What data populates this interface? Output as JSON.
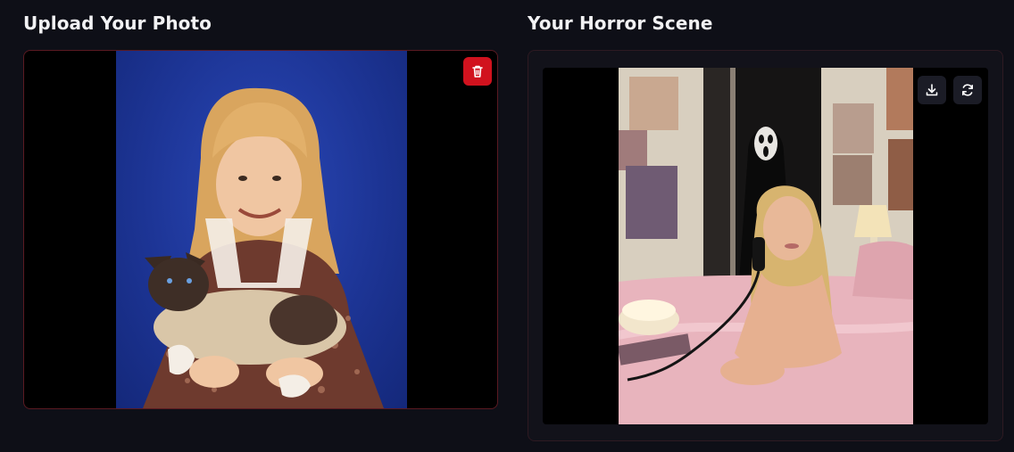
{
  "upload": {
    "title": "Upload Your Photo",
    "delete_icon": "trash-icon"
  },
  "result": {
    "title": "Your Horror Scene",
    "download_icon": "download-icon",
    "regenerate_icon": "refresh-icon"
  },
  "colors": {
    "background": "#0e0f17",
    "accent_red": "#d1121e",
    "border_red": "#5a1a22"
  }
}
